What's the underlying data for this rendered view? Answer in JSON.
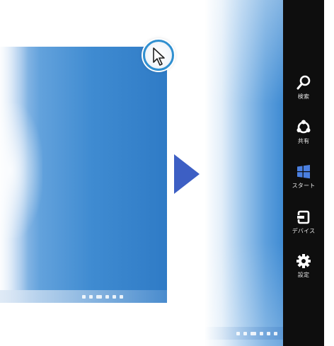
{
  "charms": [
    {
      "icon": "search-icon",
      "label": "検索"
    },
    {
      "icon": "share-icon",
      "label": "共有"
    },
    {
      "icon": "windows-start-icon",
      "label": "スタート"
    },
    {
      "icon": "devices-icon",
      "label": "デバイス"
    },
    {
      "icon": "settings-gear-icon",
      "label": "設定"
    }
  ],
  "colors": {
    "charms_background": "#0e0e0e",
    "cursor_ring": "#2f8fd0",
    "transition_arrow": "#3d5fc4",
    "start_logo": "#4a7fe0",
    "desktop_blue": "#3f8bd1"
  }
}
